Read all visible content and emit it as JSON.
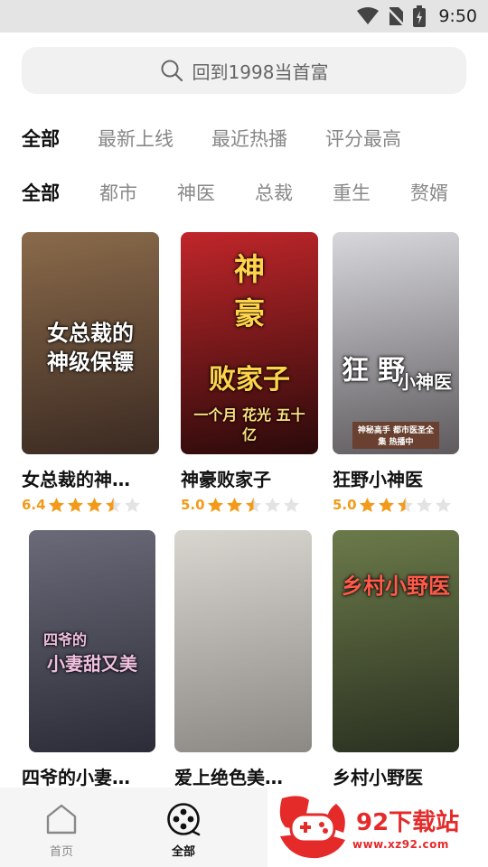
{
  "status_bar": {
    "time": "9:50"
  },
  "search": {
    "placeholder": "回到1998当首富"
  },
  "sort_tabs": [
    {
      "label": "全部",
      "active": true
    },
    {
      "label": "最新上线",
      "active": false
    },
    {
      "label": "最近热播",
      "active": false
    },
    {
      "label": "评分最高",
      "active": false
    }
  ],
  "genre_tabs": [
    {
      "label": "全部",
      "active": true
    },
    {
      "label": "都市",
      "active": false
    },
    {
      "label": "神医",
      "active": false
    },
    {
      "label": "总裁",
      "active": false
    },
    {
      "label": "重生",
      "active": false
    },
    {
      "label": "赘婿",
      "active": false
    }
  ],
  "cards": [
    {
      "title": "女总裁的神…",
      "rating": "6.4",
      "stars": 3.5,
      "poster_text": [
        "女总裁的",
        "神级保镖"
      ],
      "colors": [
        "#8a6a4a",
        "#3b2a22"
      ]
    },
    {
      "title": "神豪败家子",
      "rating": "5.0",
      "stars": 2.5,
      "poster_text": [
        "神豪",
        "败家子",
        "一个月 花光 五十亿"
      ],
      "colors": [
        "#c0262a",
        "#2a0a0a"
      ]
    },
    {
      "title": "狂野小神医",
      "rating": "5.0",
      "stars": 2.5,
      "poster_text": [
        "狂野",
        "小神医",
        "神秘高手 都市医圣全集 热播中"
      ],
      "colors": [
        "#d8d8dc",
        "#5e5a5e"
      ]
    },
    {
      "title": "四爷的小妻…",
      "rating": "",
      "stars": 0,
      "poster_text": [
        "四爷的",
        "小妻甜又美"
      ],
      "colors": [
        "#6a6a78",
        "#2c2c38"
      ]
    },
    {
      "title": "爱上绝色美…",
      "rating": "",
      "stars": 0,
      "poster_text": [],
      "colors": [
        "#d9d6d0",
        "#8c8884"
      ]
    },
    {
      "title": "乡村小野医",
      "rating": "",
      "stars": 0,
      "poster_text": [
        "乡村小野医"
      ],
      "colors": [
        "#6b7a4a",
        "#2a3020"
      ]
    }
  ],
  "bottom_nav": [
    {
      "label": "首页",
      "icon": "home-icon",
      "active": false
    },
    {
      "label": "全部",
      "icon": "film-reel-icon",
      "active": true
    }
  ],
  "watermark": {
    "title": "92下载站",
    "url": "www.xz92.com"
  },
  "colors": {
    "accent": "#f39a1a",
    "star_empty": "#e3e3e3",
    "watermark": "#e52a2a"
  }
}
